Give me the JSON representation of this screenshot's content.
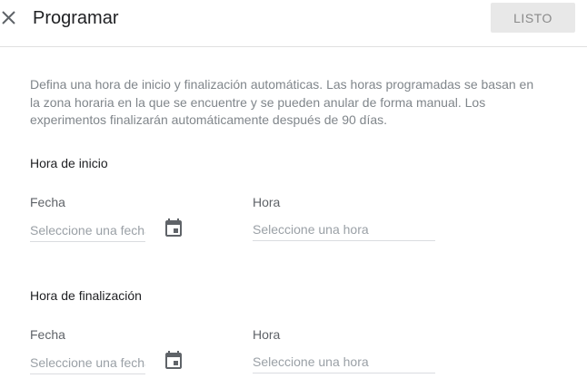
{
  "header": {
    "title": "Programar",
    "done_label": "LISTO"
  },
  "description": "Defina una hora de inicio y finalización automáticas. Las horas programadas se basan en la zona horaria en la que se encuentre y se pueden anular de forma manual. Los experimentos finalizarán automáticamente después de 90 días.",
  "start": {
    "title": "Hora de inicio",
    "date_label": "Fecha",
    "date_placeholder": "Seleccione una fecha",
    "time_label": "Hora",
    "time_placeholder": "Seleccione una hora"
  },
  "end": {
    "title": "Hora de finalización",
    "date_label": "Fecha",
    "date_placeholder": "Seleccione una fecha",
    "time_label": "Hora",
    "time_placeholder": "Seleccione una hora"
  },
  "icons": {
    "close": "close-icon",
    "calendar": "calendar-icon"
  },
  "colors": {
    "icon": "#5f6368",
    "done_bg": "#e8e8e8",
    "done_text": "#8a8a8a"
  }
}
